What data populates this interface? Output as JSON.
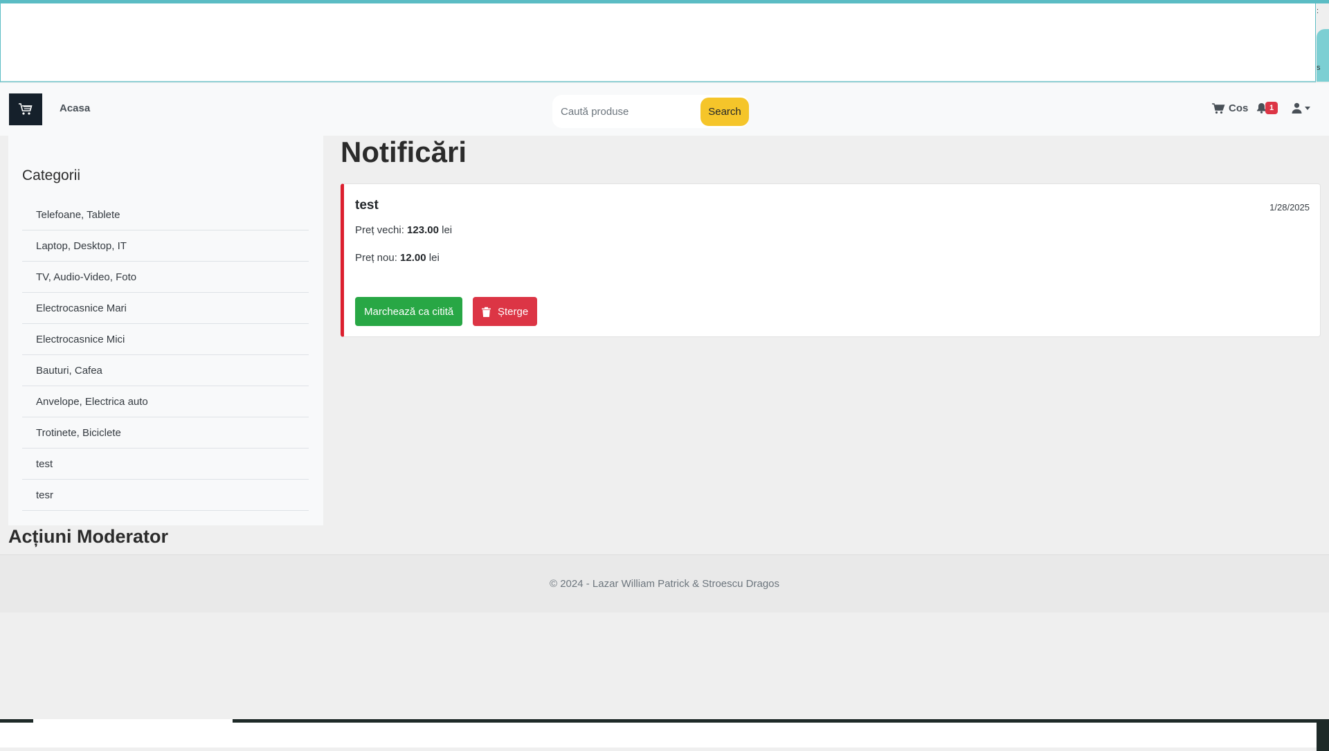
{
  "navbar": {
    "home_label": "Acasa",
    "search_placeholder": "Caută produse",
    "search_button": "Search",
    "cart_label": "Cos",
    "notification_count": "1"
  },
  "sidebar": {
    "title": "Categorii",
    "items": [
      {
        "label": "Telefoane, Tablete"
      },
      {
        "label": "Laptop, Desktop, IT"
      },
      {
        "label": "TV, Audio-Video, Foto"
      },
      {
        "label": "Electrocasnice Mari"
      },
      {
        "label": "Electrocasnice Mici"
      },
      {
        "label": "Bauturi, Cafea"
      },
      {
        "label": "Anvelope, Electrica auto"
      },
      {
        "label": "Trotinete, Biciclete"
      },
      {
        "label": "test"
      },
      {
        "label": "tesr"
      }
    ]
  },
  "main": {
    "title": "Notificări",
    "notification": {
      "title": "test",
      "date": "1/28/2025",
      "old_price_label": "Preț vechi:",
      "old_price_value": "123.00",
      "new_price_label": "Preț nou:",
      "new_price_value": "12.00",
      "currency": "lei",
      "mark_read_label": "Marchează ca citită",
      "delete_label": "Șterge"
    }
  },
  "moderator": {
    "title": "Acțiuni Moderator"
  },
  "footer": {
    "text": "© 2024 - Lazar William Patrick & Stroescu Dragos"
  },
  "colors": {
    "accent_teal": "#5bbcc4",
    "search_button": "#f5c52a",
    "success": "#28a745",
    "danger": "#dc3545",
    "card_border_accent": "#dc1f2e"
  },
  "icons": {
    "brand": "shopping-cart-icon",
    "cart": "shopping-cart-icon",
    "bell": "bell-icon",
    "user": "user-icon",
    "delete": "trash-icon"
  }
}
